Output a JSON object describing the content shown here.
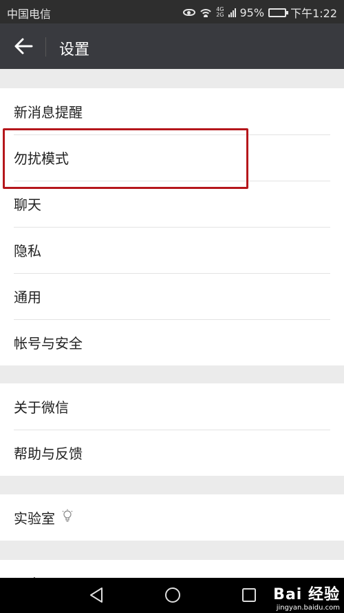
{
  "status_bar": {
    "carrier": "中国电信",
    "network": [
      "4G",
      "2G"
    ],
    "battery": "95%",
    "time": "下午1:22"
  },
  "header": {
    "title": "设置"
  },
  "settings": {
    "group1": [
      {
        "label": "新消息提醒"
      },
      {
        "label": "勿扰模式"
      },
      {
        "label": "聊天"
      },
      {
        "label": "隐私"
      },
      {
        "label": "通用"
      },
      {
        "label": "帐号与安全"
      }
    ],
    "group2": [
      {
        "label": "关于微信"
      },
      {
        "label": "帮助与反馈"
      }
    ],
    "group3": [
      {
        "label": "实验室"
      }
    ],
    "group4": [
      {
        "label": "退出"
      }
    ]
  },
  "watermark": {
    "main": "Bai 经验",
    "sub": "jingyan.baidu.com"
  },
  "colors": {
    "highlight": "#b5161b",
    "titlebar": "#393a3f",
    "battery": "#35b53a"
  }
}
